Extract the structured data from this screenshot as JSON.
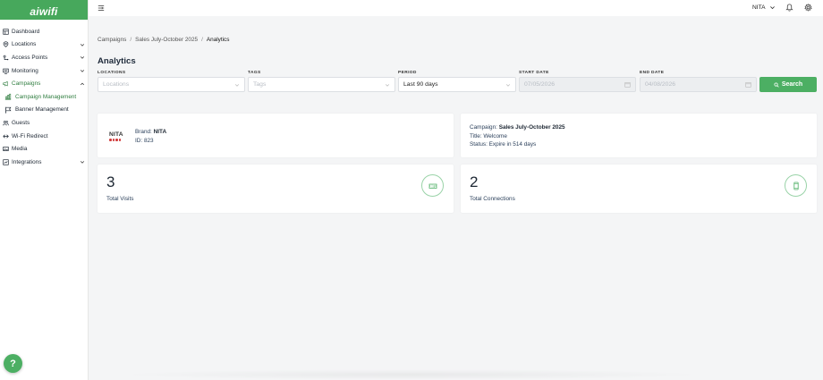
{
  "app": {
    "logo_text": "aiwifi",
    "brand_color": "#47a85c"
  },
  "sidebar": {
    "items": [
      {
        "label": "Dashboard",
        "icon": "dashboard-icon"
      },
      {
        "label": "Locations",
        "icon": "location-pin-icon",
        "expandable": true
      },
      {
        "label": "Access Points",
        "icon": "access-point-icon",
        "expandable": true
      },
      {
        "label": "Monitoring",
        "icon": "monitor-icon",
        "expandable": true
      },
      {
        "label": "Campaigns",
        "icon": "megaphone-icon",
        "expandable": true,
        "expanded": true
      },
      {
        "label": "Guests",
        "icon": "guests-icon"
      },
      {
        "label": "Wi-Fi Redirect",
        "icon": "redirect-icon"
      },
      {
        "label": "Media",
        "icon": "media-icon"
      },
      {
        "label": "Integrations",
        "icon": "integrations-icon",
        "expandable": true
      }
    ],
    "campaign_subitems": [
      {
        "label": "Campaign Management",
        "icon": "chart-icon",
        "active": true
      },
      {
        "label": "Banner Management",
        "icon": "flag-icon"
      }
    ]
  },
  "topbar": {
    "user": "NITA"
  },
  "breadcrumb": {
    "items": [
      "Campaigns",
      "Sales July-October 2025",
      "Analytics"
    ]
  },
  "page": {
    "title": "Analytics"
  },
  "filters": {
    "locations": {
      "label": "LOCATIONS",
      "placeholder": "Locations"
    },
    "tags": {
      "label": "TAGS",
      "placeholder": "Tags"
    },
    "period": {
      "label": "PERIOD",
      "value": "Last 90 days"
    },
    "start_date": {
      "label": "START DATE",
      "value": "07/05/2026"
    },
    "end_date": {
      "label": "END DATE",
      "value": "04/08/2026"
    },
    "search_label": "Search"
  },
  "brand_card": {
    "logo_word": "NITA",
    "brand_prefix": "Brand:",
    "brand_name": "NITA",
    "id_prefix": "ID:",
    "id_value": "823"
  },
  "campaign_card": {
    "campaign_prefix": "Campaign:",
    "campaign_name": "Sales July-October 2025",
    "title_line": "Title: Welcome",
    "status_line": "Status: Expire in 514 days"
  },
  "stats": [
    {
      "value": "3",
      "label": "Total Visits",
      "icon": "ticket-icon"
    },
    {
      "value": "2",
      "label": "Total Connections",
      "icon": "phone-icon"
    }
  ],
  "help": {
    "label": "?"
  }
}
